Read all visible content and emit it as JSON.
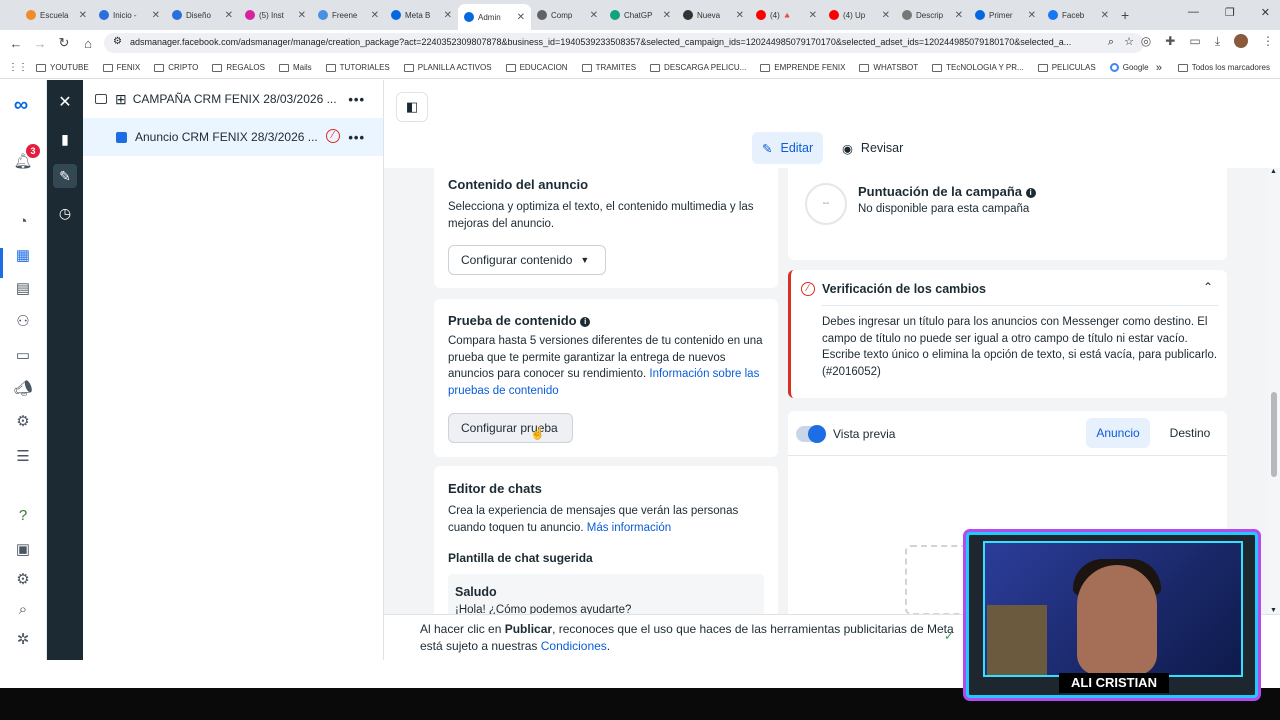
{
  "browser": {
    "tabs": [
      {
        "title": "Escuela",
        "color": "#f28b2c"
      },
      {
        "title": "Inicio -",
        "color": "#2a6fdb"
      },
      {
        "title": "Diseño",
        "color": "#2a6fdb"
      },
      {
        "title": "(5) Inst",
        "color": "#d6249f"
      },
      {
        "title": "Freene",
        "color": "#4a90e2"
      },
      {
        "title": "Meta B",
        "color": "#0668e1"
      },
      {
        "title": "Admin",
        "color": "#0668e1",
        "active": true
      },
      {
        "title": "Comp",
        "color": "#5f6368"
      },
      {
        "title": "ChatGP",
        "color": "#10a37f"
      },
      {
        "title": "Nueva",
        "color": "#333333"
      },
      {
        "title": "(4) 🔺",
        "color": "#ff0000"
      },
      {
        "title": "(4) Up",
        "color": "#ff0000"
      },
      {
        "title": "Descrip",
        "color": "#777777"
      },
      {
        "title": "Primer",
        "color": "#0668e1"
      },
      {
        "title": "Faceb",
        "color": "#1877f2"
      }
    ],
    "url": "adsmanager.facebook.com/adsmanager/manage/creation_package?act=2240352309807878&business_id=1940539233508357&selected_campaign_ids=120244985079170170&selected_adset_ids=120244985079180170&selected_a...",
    "bookmarks": [
      "YOUTUBE",
      "FENIX",
      "CRIPTO",
      "REGALOS",
      "Mails",
      "TUTORIALES",
      "PLANILLA ACTIVOS",
      "EDUCACION",
      "TRAMITES",
      "DESCARGA PELICU...",
      "EMPRENDE FENIX",
      "WHATSBOT",
      "TEcNOLOGIA Y PR...",
      "PELICULAS",
      "Google"
    ],
    "bookmarks_more": "»",
    "all_bookmarks": "Todos los marcadores"
  },
  "rail": {
    "notifications_badge": "3"
  },
  "tree": {
    "campaign": "CAMPAÑA CRM FENIX 28/03/2026 ...",
    "ad": "Anuncio CRM FENIX 28/3/2026 ...",
    "more": "•••"
  },
  "modes": {
    "edit": "Editar",
    "review": "Revisar"
  },
  "content_section": {
    "title": "Contenido del anuncio",
    "description": "Selecciona y optimiza el texto, el contenido multimedia y las mejoras del anuncio.",
    "button": "Configurar contenido"
  },
  "test_section": {
    "title": "Prueba de contenido",
    "description": "Compara hasta 5 versiones diferentes de tu contenido en una prueba que te permite garantizar la entrega de nuevos anuncios para conocer su rendimiento.",
    "link": "Información sobre las pruebas de contenido",
    "button": "Configurar prueba"
  },
  "chat_section": {
    "title": "Editor de chats",
    "description": "Crea la experiencia de mensajes que verán las personas cuando toquen tu anuncio.",
    "link": "Más información",
    "template_label": "Plantilla de chat sugerida",
    "template_name": "Saludo",
    "template_text": "¡Hola! ¿Cómo podemos ayudarte?"
  },
  "score": {
    "placeholder": "--",
    "title": "Puntuación de la campaña",
    "subtitle": "No disponible para esta campaña"
  },
  "verification": {
    "title": "Verificación de los cambios",
    "message": "Debes ingresar un título para los anuncios con Messenger como destino. El campo de título no puede ser igual a otro campo de título ni estar vacío. Escribe texto único o elimina la opción de texto, si está vacía, para publicarlo. (#2016052)"
  },
  "preview": {
    "label": "Vista previa",
    "tab_ad": "Anuncio",
    "tab_destination": "Destino"
  },
  "footer": {
    "prefix": "Al hacer clic en ",
    "publish": "Publicar",
    "middle": ", reconoces que el uso que haces de las herramientas publicitarias de Meta está sujeto a nuestras ",
    "terms": "Condiciones",
    "suffix": "."
  },
  "webcam": {
    "name": "ALI CRISTIAN"
  },
  "colors": {
    "accent": "#0a5dd7",
    "error": "#d93025",
    "rail_dark": "#1c2b33"
  }
}
